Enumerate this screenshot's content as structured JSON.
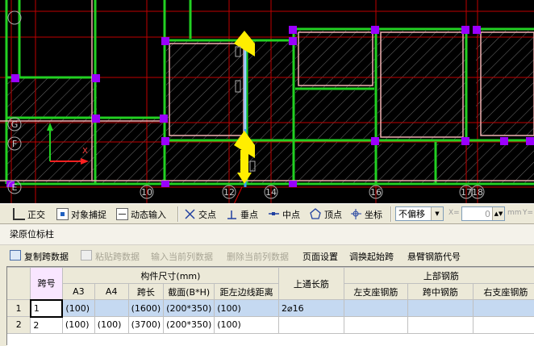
{
  "cad": {
    "axis_labels": [
      "G",
      "F",
      "E"
    ],
    "grid_numbers": [
      "10",
      "12",
      "14",
      "16",
      "17",
      "18"
    ],
    "ucs_x": "X",
    "colors": {
      "background": "#000000",
      "beam_green": "#22d022",
      "beam_pink": "#f0b0b0",
      "column_purple": "#9a00ff",
      "axis_red": "#c00000",
      "highlight_yellow": "#ffee00",
      "selected_blue": "#3aa0ff"
    }
  },
  "snap_toolbar": {
    "items": [
      {
        "label": "正交",
        "icon": "ortho-icon"
      },
      {
        "label": "对象捕捉",
        "icon": "snap-icon"
      },
      {
        "label": "动态输入",
        "icon": "dynamic-input-icon"
      },
      {
        "label": "交点",
        "icon": "intersection-icon"
      },
      {
        "label": "垂点",
        "icon": "perpendicular-icon"
      },
      {
        "label": "中点",
        "icon": "midpoint-icon"
      },
      {
        "label": "顶点",
        "icon": "vertex-icon"
      },
      {
        "label": "坐标",
        "icon": "coordinate-icon"
      }
    ],
    "offset_mode": "不偏移",
    "x_label": "X=",
    "x_value": "0",
    "unit": "mm",
    "y_label": "Y="
  },
  "panel": {
    "title": "梁原位标柱"
  },
  "grid_toolbar": {
    "copy": "复制跨数据",
    "paste": "粘贴跨数据",
    "input_col": "输入当前列数据",
    "delete_col": "删除当前列数据",
    "page_setup": "页面设置",
    "swap_span": "调换起始跨",
    "cantilever": "悬臂钢筋代号"
  },
  "table": {
    "h_span": "跨号",
    "h_size_group": "构件尺寸(mm)",
    "h_a3": "A3",
    "h_a4": "A4",
    "h_len": "跨长",
    "h_section": "截面(B*H)",
    "h_edge": "距左边线距离",
    "h_top_through": "上通长筋",
    "h_top_group": "上部钢筋",
    "h_left_seat": "左支座钢筋",
    "h_mid": "跨中钢筋",
    "h_right_seat": "右支座钢筋",
    "rows": [
      {
        "idx": "1",
        "span": "1",
        "a3": "(100)",
        "a4": "",
        "len": "(1600)",
        "section": "(200*350)",
        "edge": "(100)",
        "top": "2⌀16"
      },
      {
        "idx": "2",
        "span": "2",
        "a3": "(100)",
        "a4": "(100)",
        "len": "(3700)",
        "section": "(200*350)",
        "edge": "(100)",
        "top": ""
      }
    ]
  }
}
